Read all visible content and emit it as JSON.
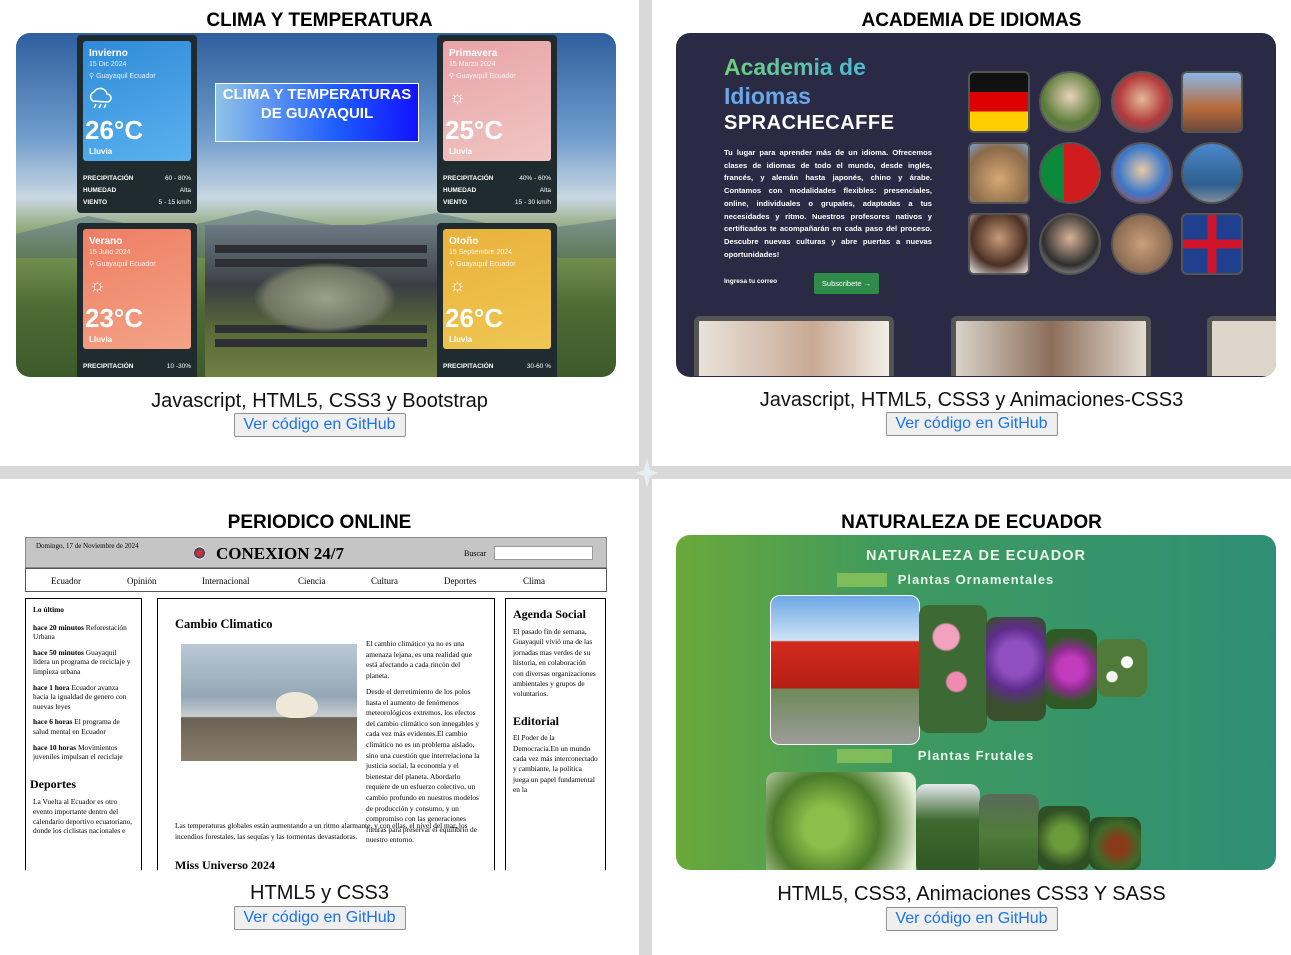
{
  "cards": [
    {
      "title": "CLIMA Y TEMPERATURA",
      "tech": "Javascript, HTML5, CSS3 y Bootstrap",
      "github": "Ver código en GitHub"
    },
    {
      "title": "ACADEMIA DE IDIOMAS",
      "tech": "Javascript, HTML5, CSS3 y Animaciones-CSS3",
      "github": "Ver código en GitHub"
    },
    {
      "title": "PERIODICO ONLINE",
      "tech": "HTML5 y CSS3",
      "github": "Ver código en GitHub"
    },
    {
      "title": "NATURALEZA DE ECUADOR",
      "tech": "HTML5, CSS3, Animaciones CSS3 Y SASS",
      "github": "Ver código en GitHub"
    }
  ],
  "clima": {
    "banner": "CLIMA Y TEMPERATURAS DE GUAYAQUIL",
    "seasons": [
      {
        "name": "Invierno",
        "date": "15 Dic 2024",
        "loc": "Guayaquil Ecuador",
        "temp": "26°C",
        "cond": "Lluvia",
        "icon": "cloud-rain-icon",
        "precip": "60 - 80%",
        "hum": "Alta",
        "wind": "5 - 15 km/h",
        "color_a": "#2f8bd8",
        "color_b": "#5ab2ee"
      },
      {
        "name": "Primavera",
        "date": "15 Marzo 2024",
        "loc": "Guayaquil Ecuador",
        "temp": "25°C",
        "cond": "Lluvia",
        "icon": "sun-icon",
        "precip": "40% - 60%",
        "hum": "Alta",
        "wind": "15 - 30 km/h",
        "color_a": "#e8a4a8",
        "color_b": "#f0c5c3"
      },
      {
        "name": "Verano",
        "date": "15 Julio 2024",
        "loc": "Guayaquil Ecuador",
        "temp": "23°C",
        "cond": "Lluvia",
        "icon": "sun-icon",
        "precip": "10 -30%",
        "color_a": "#ee7e63",
        "color_b": "#f3a387"
      },
      {
        "name": "Otoño",
        "date": "15 Septiembre 2024",
        "loc": "Guayaquil Ecuador",
        "temp": "26°C",
        "cond": "Lluvia",
        "icon": "sun-icon",
        "precip": "30-60 %",
        "color_a": "#e8b23c",
        "color_b": "#f0c653"
      }
    ],
    "labels": {
      "precip": "PRECIPITACIÓN",
      "hum": "HUMEDAD",
      "wind": "VIENTO"
    }
  },
  "acad": {
    "line1": "Academia de",
    "line2": "Idiomas",
    "line3": "SPRACHECAFFE",
    "desc": "Tu lugar para aprender más de un idioma. Ofrecemos clases de idiomas de todo el mundo, desde inglés, francés, y alemán hasta japonés, chino y árabe. Contamos con modalidades flexibles: presenciales, online, individuales o grupales, adaptadas a tus necesidades y ritmo. Nuestros profesores nativos y certificados te acompañarán en cada paso del proceso. Descubre nuevas culturas y abre puertas a nuevas oportunidades!",
    "email_placeholder": "Ingresa tu correo",
    "subscribe": "Subscribete →"
  },
  "peri": {
    "date": "Domingo, 17 de Noviembre de 2024",
    "title": "CONEXION 24/7",
    "search": "Buscar",
    "nav": [
      "Ecuador",
      "Opinión",
      "Internacional",
      "Ciencia",
      "Cultura",
      "Deportes",
      "Clima"
    ],
    "latest_title": "Lo último",
    "latest": [
      {
        "time": "hace 20 minutos",
        "text": "Reforestación Urbana"
      },
      {
        "time": "hace 50 minutos",
        "text": "Guayaquil lidera un programa de reciclaje y limpieza urbana"
      },
      {
        "time": "hace 1 hora",
        "text": "Ecuador avanza hacia la igualdad de genero con nuevas leyes"
      },
      {
        "time": "hace 6 horas",
        "text": "El programa de salud mental en Ecuador"
      },
      {
        "time": "hace 10 horas",
        "text": "Movimientos juveniles impulsan el reciclaje"
      }
    ],
    "sports_title": "Deportes",
    "sports_text": "La Vuelta al Ecuador es otro evento importante dentro del calendario deportivo ecuatoriano, donde los ciclistas nacionales e",
    "article_title": "Cambio Climatico",
    "article_p1": "El cambio climático ya no es una amenaza lejana, es una realidad que está afectando a cada rincón del planeta.",
    "article_p2": "Desde el derretimiento de los polos hasta el aumento de fenómenos meteorológicos extremos, los efectos del cambio climático son innegables y cada vez más evidentes.El cambio climático no es un problema aislado, sino una cuestión que interrelaciona la justicia social, la economía y el bienestar del planeta. Abordarlo requiere de un esfuerzo colectivo, un cambio profundo en nuestros modelos de producción y consumo, y un compromiso con las generaciones futuras para preservar el equilibrio de nuestro entorno.",
    "article_p3": "Las temperaturas globales están aumentando a un ritmo alarmante, y con ellas, el nivel del mar, los incendios forestales, las sequías y las tormentas devastadoras.",
    "article2_title": "Miss Universo 2024",
    "agenda_title": "Agenda Social",
    "agenda_text": "El pasado fin de semana, Guayaquil vivió una de las jornadas mas verdes de su historia, en colaboración con diversas organizaciones ambientales y grupos de voluntarios.",
    "editorial_title": "Editorial",
    "editorial_text": "El Poder de la Democracia.En un mundo cada vez más interconectado y cambiante, la política juega un papel fundamental en la"
  },
  "nat": {
    "title": "NATURALEZA DE ECUADOR",
    "section1": "Plantas Ornamentales",
    "section2": "Plantas Frutales"
  }
}
